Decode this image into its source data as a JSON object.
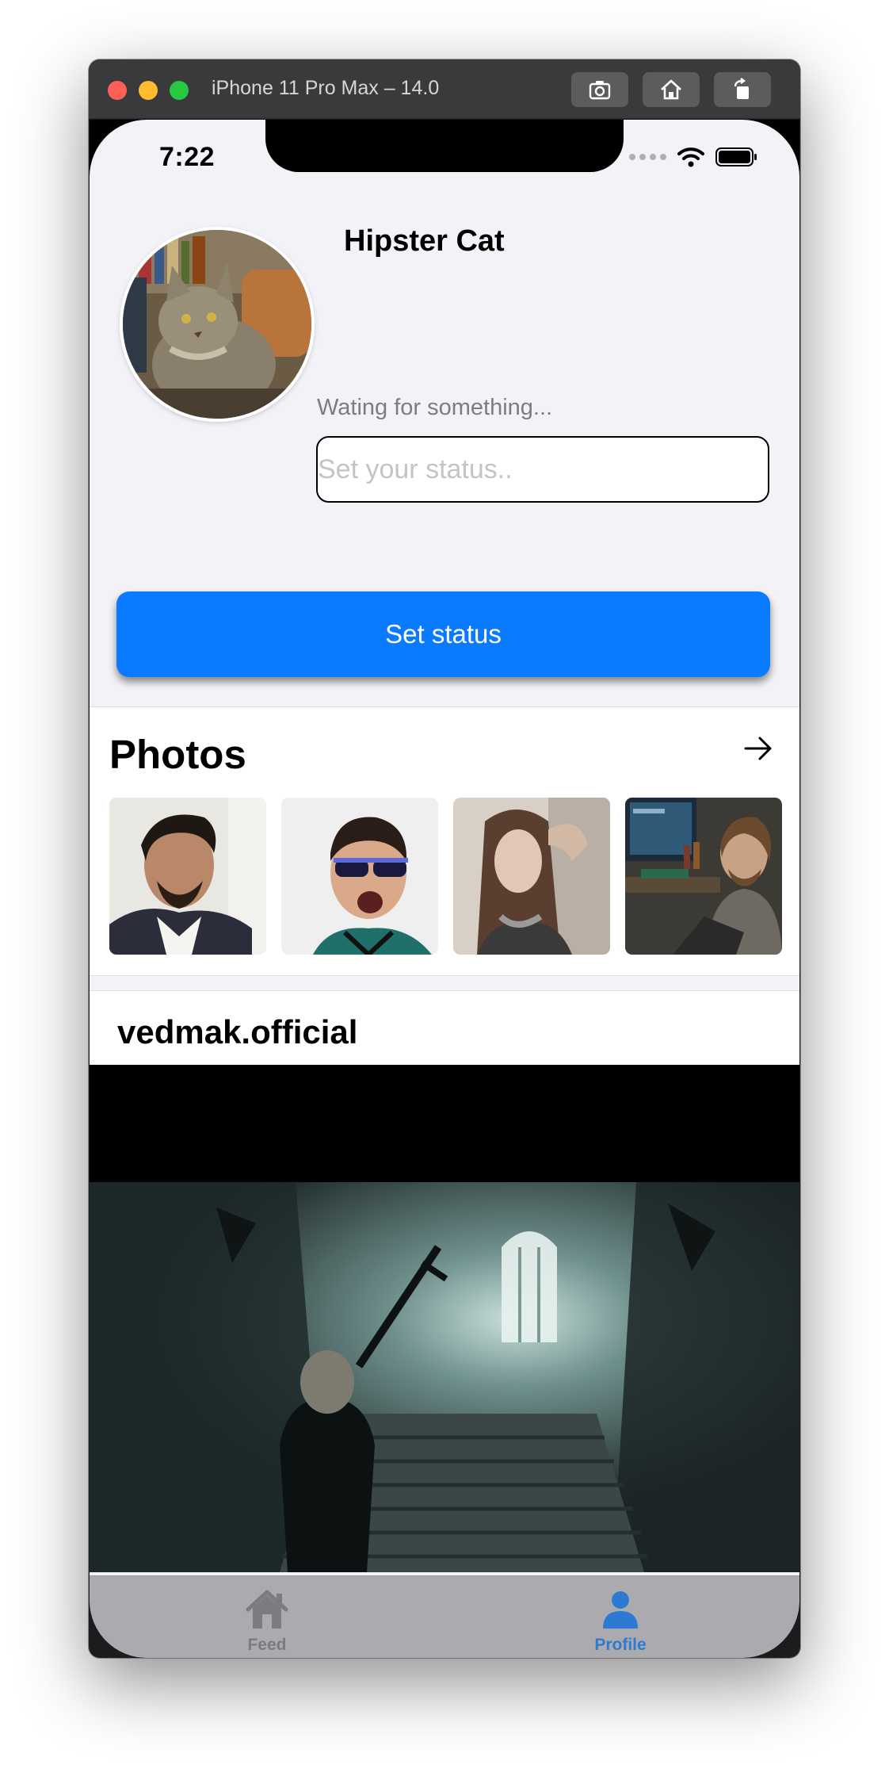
{
  "window": {
    "title": "iPhone 11 Pro Max – 14.0",
    "toolbar": [
      "screenshot-icon",
      "home-icon",
      "rotate-icon"
    ]
  },
  "status_bar": {
    "time": "7:22"
  },
  "profile": {
    "name": "Hipster Cat",
    "status": "Wating for something...",
    "status_placeholder": "Set your status..",
    "set_status_label": "Set status"
  },
  "photos": {
    "title": "Photos",
    "arrow_icon": "arrow-right-icon",
    "count_visible": 4
  },
  "post": {
    "author": "vedmak.official"
  },
  "tabbar": {
    "items": [
      {
        "label": "Feed",
        "icon": "house-icon",
        "selected": false
      },
      {
        "label": "Profile",
        "icon": "person-icon",
        "selected": true
      }
    ]
  },
  "colors": {
    "accent": "#0A7AFF",
    "tab_selected": "#2E7AD2",
    "background": "#F2F2F7"
  }
}
